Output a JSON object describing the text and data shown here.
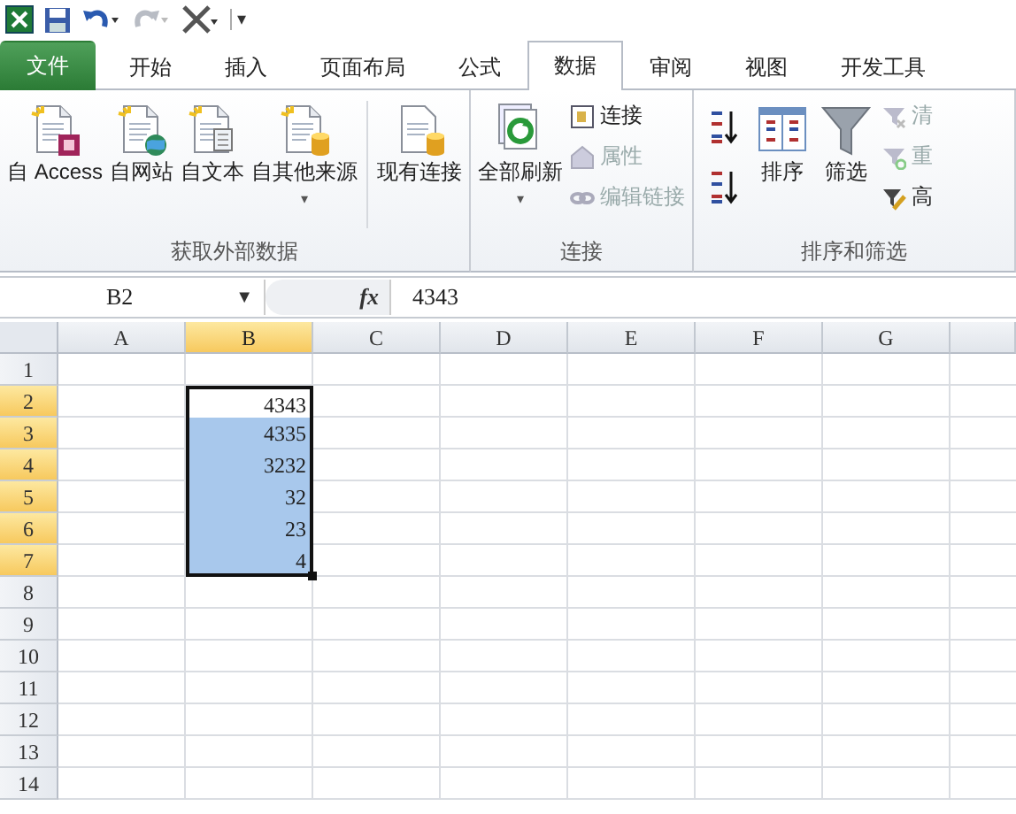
{
  "quick_access": {
    "menu": "▾"
  },
  "tabs": [
    {
      "label": "文件",
      "kind": "file",
      "selected": false
    },
    {
      "label": "开始",
      "kind": "tab",
      "selected": false
    },
    {
      "label": "插入",
      "kind": "tab",
      "selected": false
    },
    {
      "label": "页面布局",
      "kind": "tab",
      "selected": false
    },
    {
      "label": "公式",
      "kind": "tab",
      "selected": false
    },
    {
      "label": "数据",
      "kind": "tab",
      "selected": true
    },
    {
      "label": "审阅",
      "kind": "tab",
      "selected": false
    },
    {
      "label": "视图",
      "kind": "tab",
      "selected": false
    },
    {
      "label": "开发工具",
      "kind": "tab",
      "selected": false
    }
  ],
  "ribbon": {
    "groups": [
      {
        "label": "获取外部数据",
        "items": [
          {
            "kind": "large",
            "label": "自 Access"
          },
          {
            "kind": "large",
            "label": "自网站"
          },
          {
            "kind": "large",
            "label": "自文本"
          },
          {
            "kind": "large",
            "label": "自其他来源",
            "caret": "▾"
          },
          {
            "kind": "separator"
          },
          {
            "kind": "large",
            "label": "现有连接"
          }
        ]
      },
      {
        "label": "连接",
        "items": [
          {
            "kind": "large",
            "label": "全部刷新",
            "caret": "▾"
          },
          {
            "kind": "small",
            "buttons": [
              {
                "label": "连接",
                "disabled": false
              },
              {
                "label": "属性",
                "disabled": true
              },
              {
                "label": "编辑链接",
                "disabled": true
              }
            ]
          }
        ]
      },
      {
        "label": "排序和筛选",
        "items": [
          {
            "kind": "sortpair"
          },
          {
            "kind": "large",
            "label": "排序"
          },
          {
            "kind": "large",
            "label": "筛选"
          },
          {
            "kind": "small",
            "buttons": [
              {
                "label": "清",
                "disabled": true
              },
              {
                "label": "重",
                "disabled": true
              },
              {
                "label": "高",
                "disabled": false
              }
            ]
          }
        ]
      }
    ]
  },
  "formula_bar": {
    "name_box": "B2",
    "name_box_caret": "▼",
    "fx": "fx",
    "formula": "4343"
  },
  "sheet": {
    "columns": [
      {
        "label": "A",
        "selected": false
      },
      {
        "label": "B",
        "selected": true
      },
      {
        "label": "C",
        "selected": false
      },
      {
        "label": "D",
        "selected": false
      },
      {
        "label": "E",
        "selected": false
      },
      {
        "label": "F",
        "selected": false
      },
      {
        "label": "G",
        "selected": false
      },
      {
        "selected": false
      }
    ],
    "rows": [
      {
        "label": "1",
        "selected": false,
        "cells": {}
      },
      {
        "label": "2",
        "selected": true,
        "cells": {
          "B": "4343"
        }
      },
      {
        "label": "3",
        "selected": true,
        "cells": {
          "B": "4335"
        }
      },
      {
        "label": "4",
        "selected": true,
        "cells": {
          "B": "3232"
        }
      },
      {
        "label": "5",
        "selected": true,
        "cells": {
          "B": "32"
        }
      },
      {
        "label": "6",
        "selected": true,
        "cells": {
          "B": "23"
        }
      },
      {
        "label": "7",
        "selected": true,
        "cells": {
          "B": "4"
        }
      },
      {
        "label": "8",
        "selected": false,
        "cells": {}
      },
      {
        "label": "9",
        "selected": false,
        "cells": {}
      },
      {
        "label": "10",
        "selected": false,
        "cells": {}
      },
      {
        "label": "11",
        "selected": false,
        "cells": {}
      },
      {
        "label": "12",
        "selected": false,
        "cells": {}
      },
      {
        "label": "13",
        "selected": false,
        "cells": {}
      },
      {
        "label": "14",
        "selected": false,
        "cells": {}
      }
    ]
  }
}
